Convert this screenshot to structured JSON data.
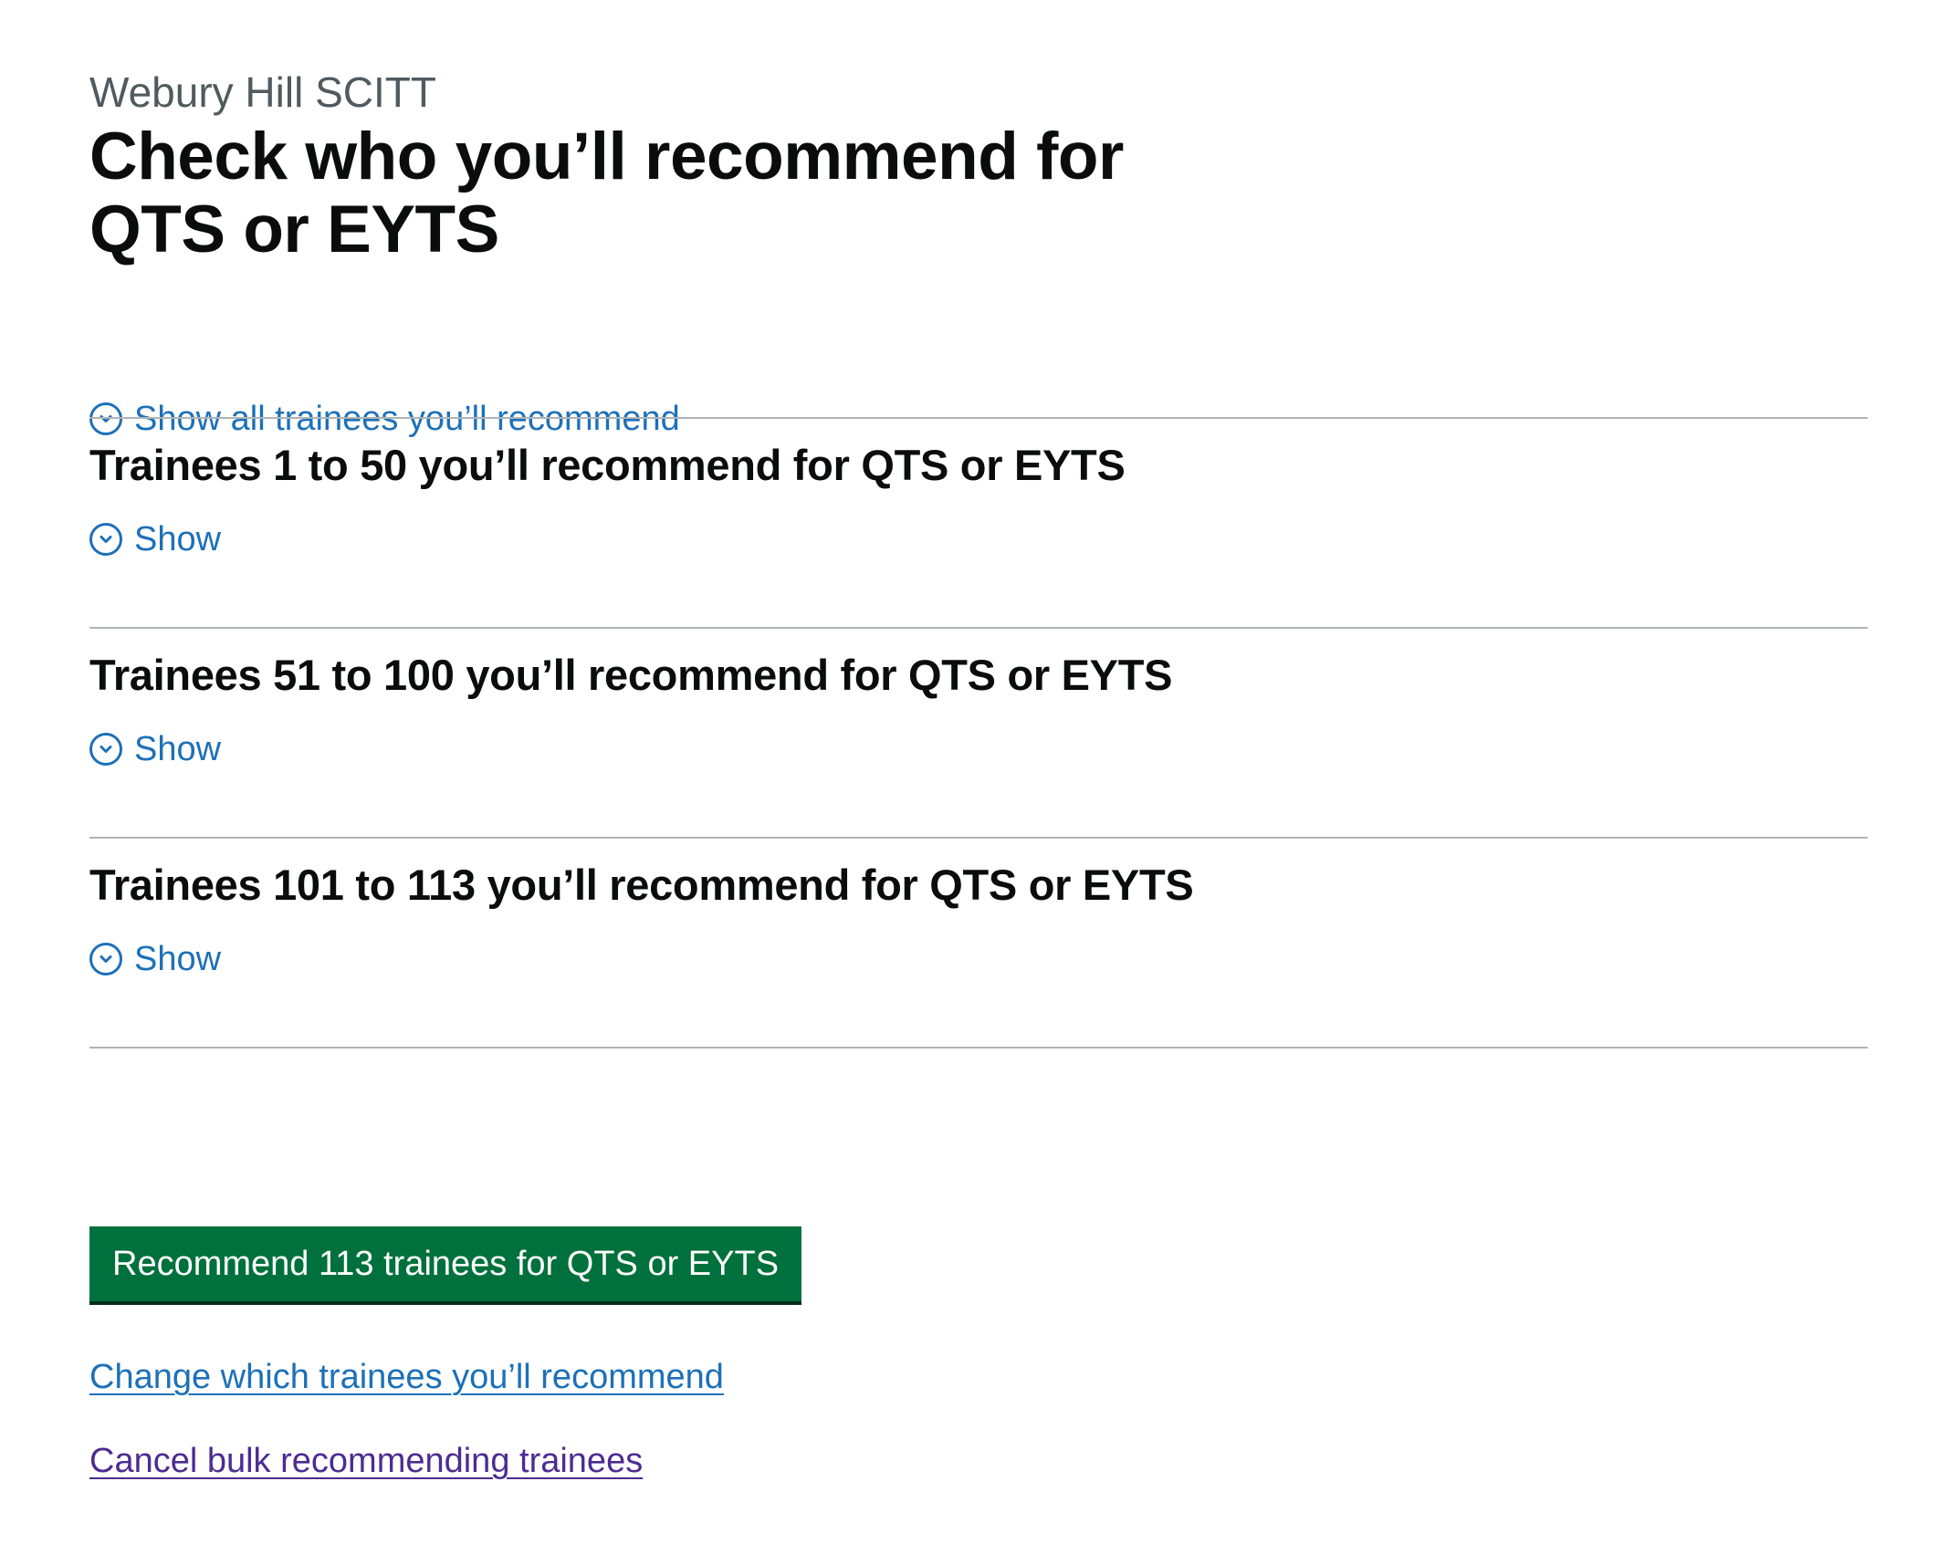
{
  "header": {
    "caption": "Webury Hill SCITT",
    "title": "Check who you’ll recommend for QTS or EYTS"
  },
  "accordion": {
    "show_all_label": "Show all trainees you’ll recommend",
    "sections": [
      {
        "heading": "Trainees 1 to 50 you’ll recommend for QTS or EYTS",
        "toggle_label": "Show"
      },
      {
        "heading": "Trainees 51 to 100 you’ll recommend for QTS or EYTS",
        "toggle_label": "Show"
      },
      {
        "heading": "Trainees 101 to 113 you’ll recommend for QTS or EYTS",
        "toggle_label": "Show"
      }
    ]
  },
  "actions": {
    "primary_button_label": "Recommend 113 trainees for QTS or EYTS",
    "change_link": "Change which trainees you’ll recommend",
    "cancel_link": "Cancel bulk recommending trainees"
  },
  "colors": {
    "link": "#1d70b8",
    "visited_link": "#4c2c92",
    "button": "#00703c",
    "text": "#0b0c0c",
    "secondary_text": "#505a5f",
    "border": "#b1b4b6"
  },
  "icons": {
    "expand": "chevron-down-circle-icon"
  }
}
